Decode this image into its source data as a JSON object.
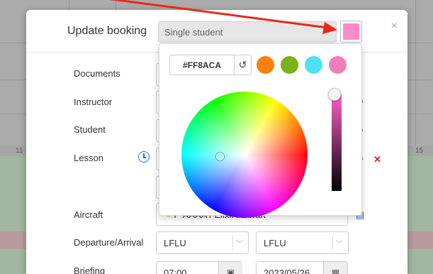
{
  "calendar": {
    "hour_labels": [
      "11",
      "15"
    ]
  },
  "modal": {
    "title": "Update booking",
    "booking_type_value": "Single student",
    "selected_color": "#ff8aca"
  },
  "fields": {
    "documents_label": "Documents",
    "instructor_label": "Instructor",
    "student_label": "Student",
    "lesson_label": "Lesson",
    "aircraft_label": "Aircraft",
    "aircraft_value": "F-AAAA / Elixir Aircraft",
    "departure_arrival_label": "Departure/Arrival",
    "departure_value": "LFLU",
    "arrival_value": "LFLU",
    "briefing_label": "Briefing",
    "briefing_time": "07:00",
    "briefing_date": "2023/05/26"
  },
  "color_picker": {
    "hex_value": "#FF8ACA",
    "presets": [
      "#ff7f0e",
      "#7ab317",
      "#4fe0f5",
      "#f07fb9"
    ]
  },
  "colors": {
    "accent": "#2d6ec7",
    "danger": "#e02020",
    "annotation_arrow": "#e8281b"
  }
}
